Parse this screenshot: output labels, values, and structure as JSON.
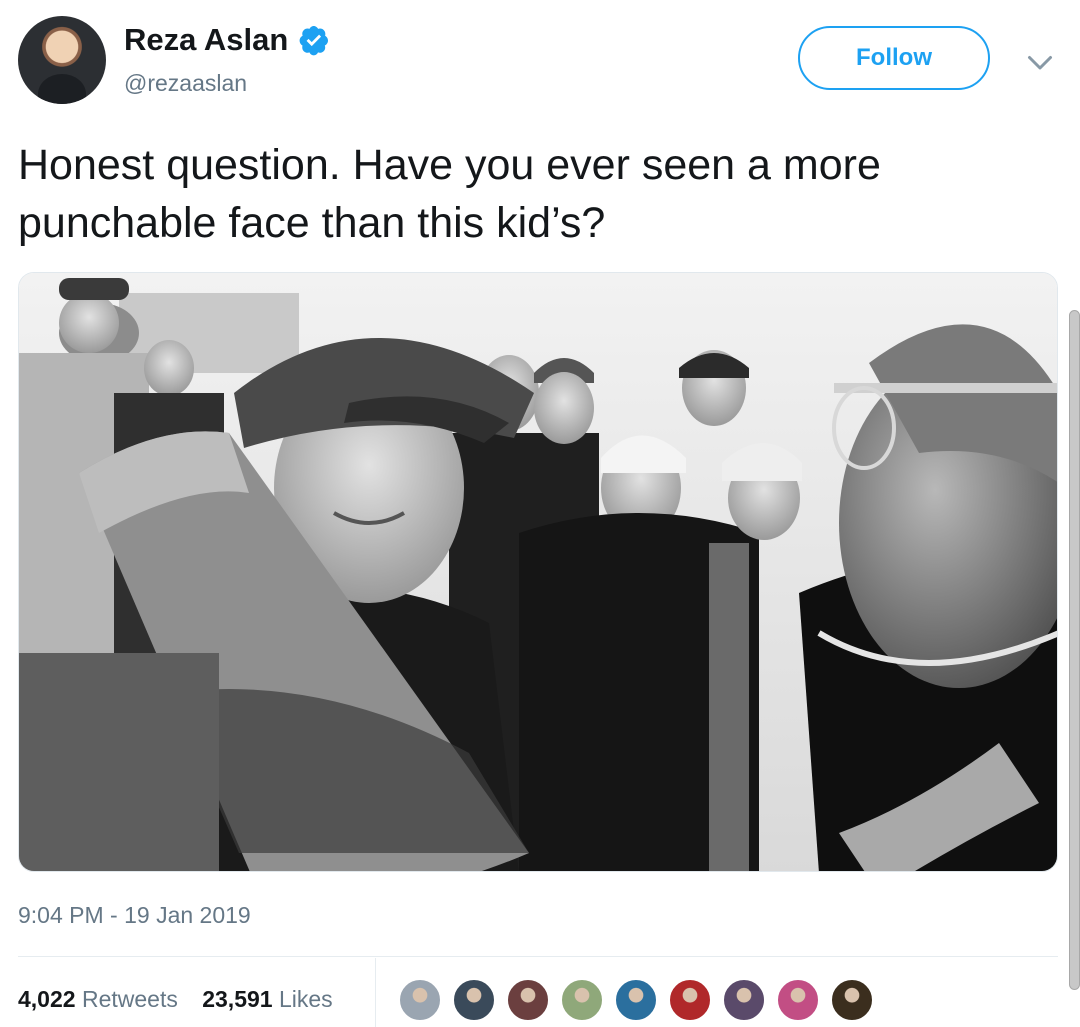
{
  "author": {
    "display_name": "Reza Aslan",
    "handle": "@rezaaslan",
    "verified": true,
    "avatar_icon": "profile-photo"
  },
  "actions": {
    "follow_label": "Follow",
    "menu_icon": "chevron-down-icon"
  },
  "tweet": {
    "text": "Honest question. Have you ever seen a more punchable face than this kid’s?",
    "timestamp": "9:04 PM - 19 Jan 2019"
  },
  "engagement": {
    "retweets_count": "4,022",
    "retweets_label": "Retweets",
    "likes_count": "23,591",
    "likes_label": "Likes"
  },
  "likers": [
    {
      "name": "liker-1",
      "color": "#9aa5b1"
    },
    {
      "name": "liker-2",
      "color": "#3a4a5a"
    },
    {
      "name": "liker-3",
      "color": "#6b3f3f"
    },
    {
      "name": "liker-4",
      "color": "#8fa87a"
    },
    {
      "name": "liker-5",
      "color": "#2b6f9e"
    },
    {
      "name": "liker-6",
      "color": "#b0282a"
    },
    {
      "name": "liker-7",
      "color": "#5a4a6a"
    },
    {
      "name": "liker-8",
      "color": "#c24e84"
    },
    {
      "name": "liker-9",
      "color": "#3b2e1e"
    }
  ],
  "colors": {
    "accent": "#1da1f2",
    "secondary_text": "#657786",
    "primary_text": "#14171a"
  }
}
